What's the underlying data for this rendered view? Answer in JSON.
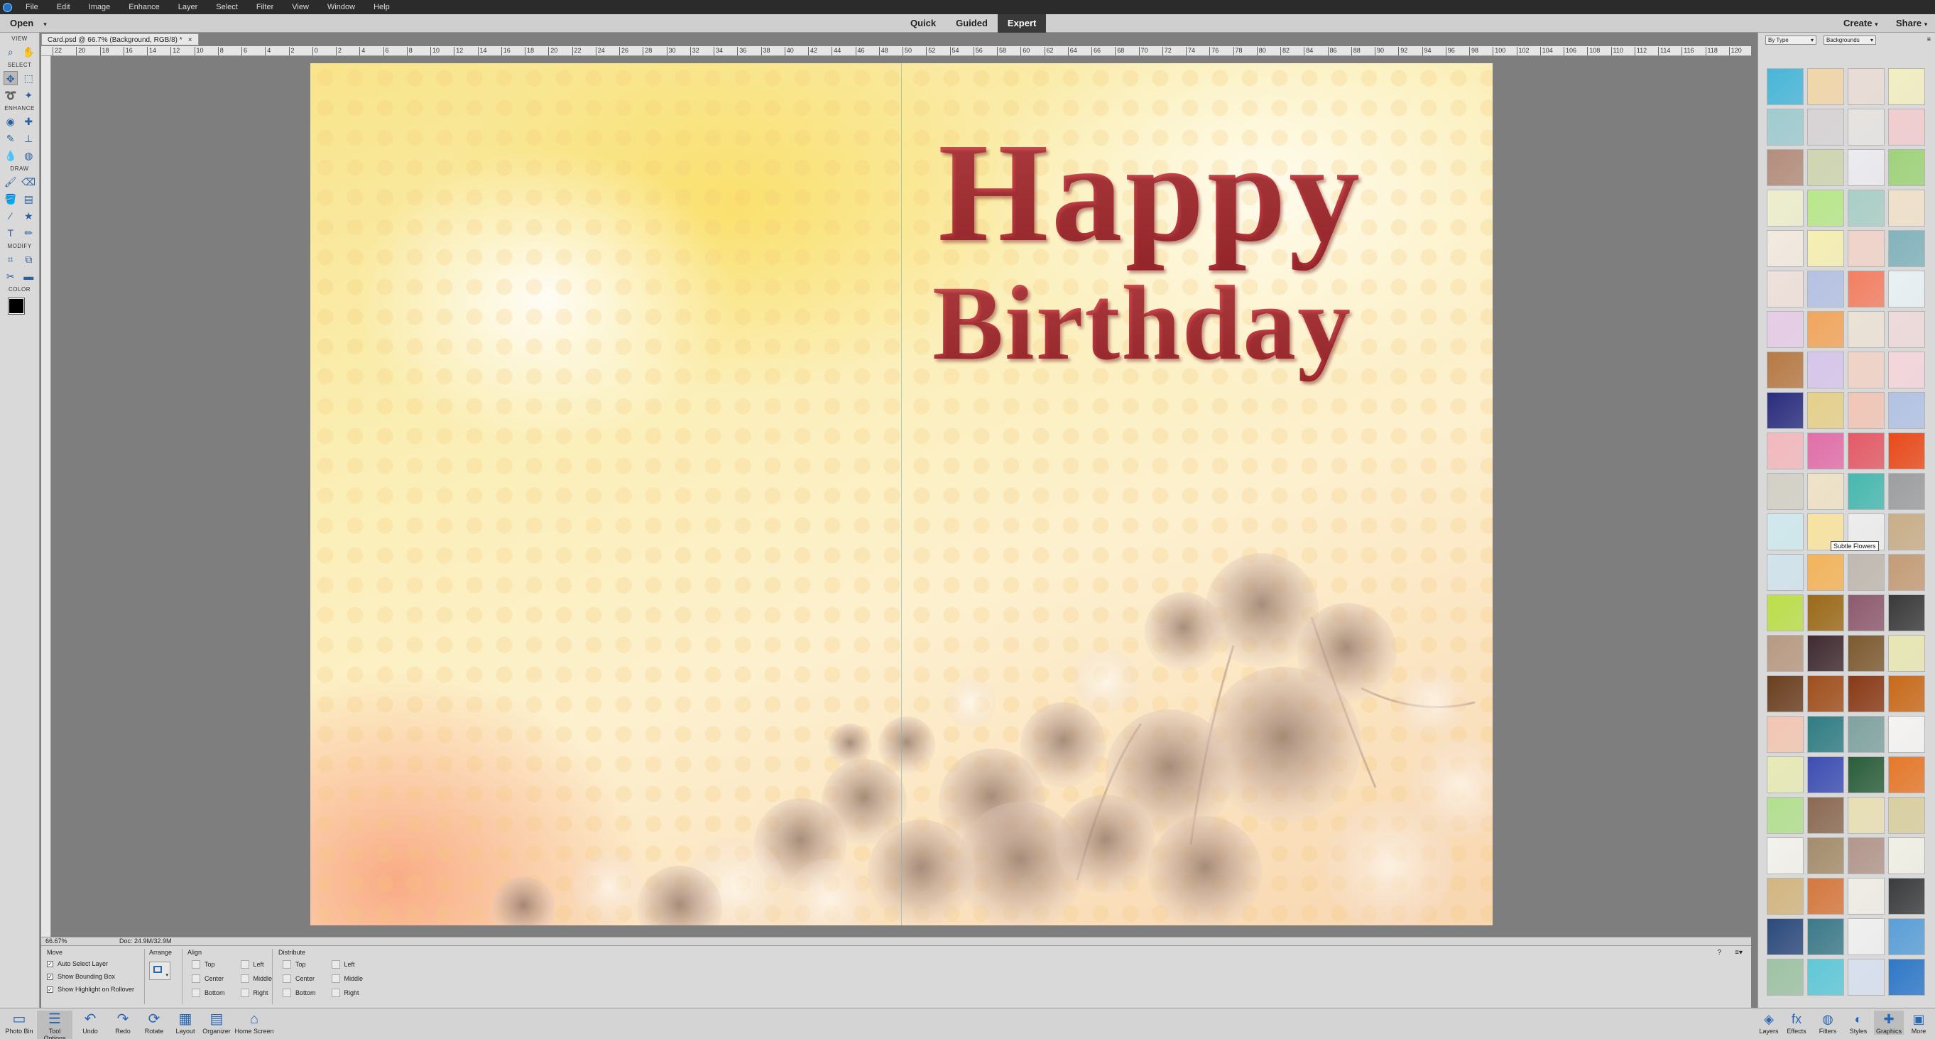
{
  "menubar": {
    "items": [
      "File",
      "Edit",
      "Image",
      "Enhance",
      "Layer",
      "Select",
      "Filter",
      "View",
      "Window",
      "Help"
    ]
  },
  "modebar": {
    "open_label": "Open",
    "modes": [
      "Quick",
      "Guided",
      "Expert"
    ],
    "active_mode": "Expert",
    "create_label": "Create",
    "share_label": "Share"
  },
  "tools": {
    "sections": [
      "VIEW",
      "SELECT",
      "ENHANCE",
      "DRAW",
      "MODIFY",
      "COLOR"
    ],
    "foreground_color": "#000000",
    "background_color": "#000000"
  },
  "document": {
    "tab_title": "Card.psd @ 66.7% (Background, RGB/8) *",
    "ruler_ticks": [
      "22",
      "20",
      "18",
      "16",
      "14",
      "12",
      "10",
      "8",
      "6",
      "4",
      "2",
      "0",
      "2",
      "4",
      "6",
      "8",
      "10",
      "12",
      "14",
      "16",
      "18",
      "20",
      "22",
      "24",
      "26",
      "28",
      "30",
      "32",
      "34",
      "36",
      "38",
      "40",
      "42",
      "44",
      "46",
      "48",
      "50",
      "52",
      "54",
      "56",
      "58",
      "60",
      "62",
      "64",
      "66",
      "68",
      "70",
      "72",
      "74",
      "76",
      "78",
      "80",
      "82",
      "84",
      "86",
      "88",
      "90",
      "92",
      "94",
      "96",
      "98",
      "100",
      "102",
      "104",
      "106",
      "108",
      "110",
      "112",
      "114",
      "116",
      "118",
      "120"
    ]
  },
  "card": {
    "line1": "Happy",
    "line2": "Birthday",
    "text_color": "#b8343a"
  },
  "statusbar": {
    "zoom": "66.67%",
    "doc_size": "Doc: 24.9M/32.9M"
  },
  "options": {
    "move_heading": "Move",
    "checkboxes": [
      "Auto Select Layer",
      "Show Bounding Box",
      "Show Highlight on Rollover"
    ],
    "arrange_heading": "Arrange",
    "align_heading": "Align",
    "align_col1": [
      "Top",
      "Center",
      "Bottom"
    ],
    "align_col2": [
      "Left",
      "Middle",
      "Right"
    ],
    "distribute_heading": "Distribute",
    "distribute_col1": [
      "Top",
      "Center",
      "Bottom"
    ],
    "distribute_col2": [
      "Left",
      "Middle",
      "Right"
    ]
  },
  "taskbar": {
    "left": [
      {
        "label": "Photo Bin",
        "icon": "photo-bin-icon"
      },
      {
        "label": "Tool Options",
        "icon": "tool-options-icon"
      },
      {
        "label": "Undo",
        "icon": "undo-icon"
      },
      {
        "label": "Redo",
        "icon": "redo-icon"
      },
      {
        "label": "Rotate",
        "icon": "rotate-icon"
      },
      {
        "label": "Layout",
        "icon": "layout-icon"
      },
      {
        "label": "Organizer",
        "icon": "organizer-icon"
      },
      {
        "label": "Home Screen",
        "icon": "home-screen-icon"
      }
    ],
    "right": [
      {
        "label": "Layers",
        "icon": "layers-icon"
      },
      {
        "label": "Effects",
        "icon": "effects-icon"
      },
      {
        "label": "Filters",
        "icon": "filters-icon"
      },
      {
        "label": "Styles",
        "icon": "styles-icon"
      },
      {
        "label": "Graphics",
        "icon": "graphics-icon"
      },
      {
        "label": "More",
        "icon": "more-icon"
      }
    ]
  },
  "graphics_panel": {
    "filter_type": "By Type",
    "category": "Backgrounds",
    "tooltip": "Subtle Flowers",
    "thumbnail_colors": [
      "#47b6d9",
      "#f2d6a8",
      "#e9dcd6",
      "#f2efc2",
      "#9fcbd0",
      "#d8d4d6",
      "#e6e3e1",
      "#f1cdd0",
      "#b48d7c",
      "#cfd6b0",
      "#ecebf0",
      "#9fd37a",
      "#eeeecd",
      "#b8e88a",
      "#a9cfc6",
      "#f0e1ca",
      "#f3eadf",
      "#f6f0b2",
      "#f0d4c8",
      "#82b3bd",
      "#efe0da",
      "#b4c2e3",
      "#f47f62",
      "#e9f1f4",
      "#e6cde6",
      "#f2a65c",
      "#ece2d6",
      "#eedada",
      "#b77a44",
      "#d7c6ec",
      "#f1d2c6",
      "#f4d6dc",
      "#2a2d7e",
      "#e6d08a",
      "#f1c6b6",
      "#b2c3e4",
      "#f3b9be",
      "#e16fa9",
      "#e45a66",
      "#ea4a1a",
      "#d3d1c6",
      "#efe2c6",
      "#47b9af",
      "#9c9ea0",
      "#cfe9ed",
      "#f8e3a0",
      "#ededed",
      "#c9ae88",
      "#d1e3ec",
      "#f4b45a",
      "#c0b9b1",
      "#c49c77",
      "#bcdf4a",
      "#9c6a18",
      "#8d5a6e",
      "#3a3a3a",
      "#b89a82",
      "#3f2a30",
      "#7d5a2f",
      "#e8e7b3",
      "#6b3f1f",
      "#a04f1c",
      "#8a3a16",
      "#c96a1a",
      "#f3c7b3",
      "#2f7d83",
      "#7fa3a0",
      "#f5f4f2",
      "#e8eab6",
      "#3c4eb3",
      "#2a5e3a",
      "#e6782a",
      "#b3e08f",
      "#8b6a52",
      "#e8e0b4",
      "#d9cfa0",
      "#f3f2ec",
      "#a58d6c",
      "#b3978c",
      "#f1f0e6",
      "#d3b680",
      "#d5783e",
      "#f0ede6",
      "#3a3c3e",
      "#2b4a7c",
      "#3c7a8a",
      "#f0f0f0",
      "#5a9fd8",
      "#9ec3a4",
      "#5fc8d8",
      "#d8e0ee",
      "#2e78c8"
    ]
  }
}
